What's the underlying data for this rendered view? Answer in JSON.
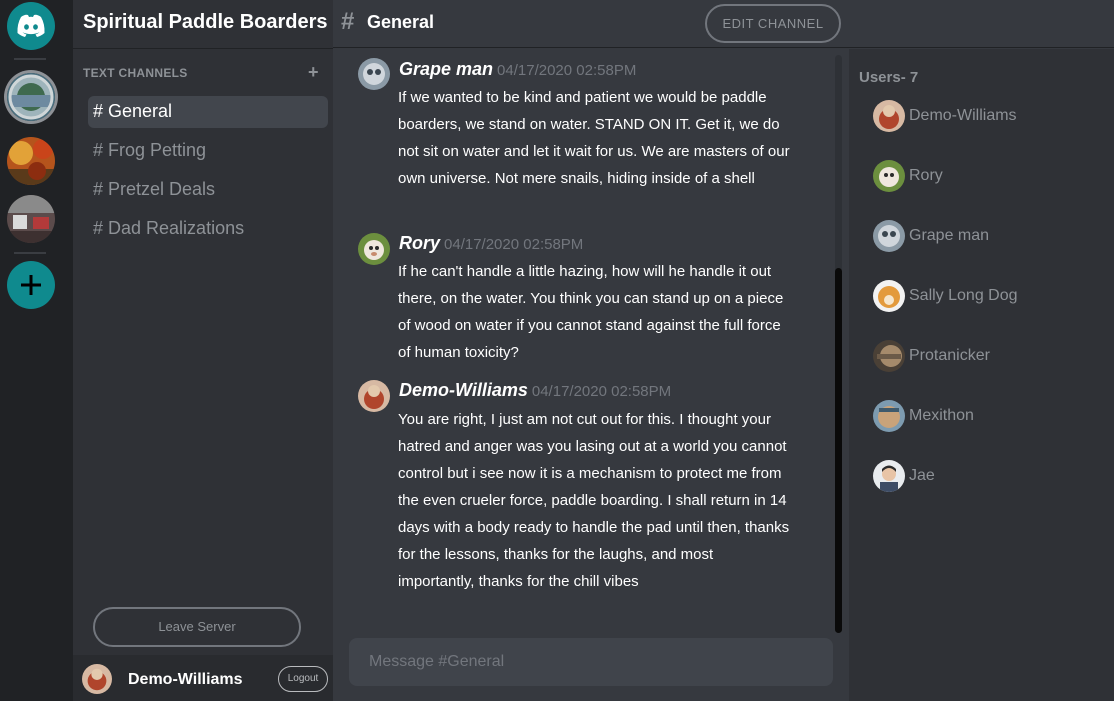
{
  "server": {
    "name": "Spiritual Paddle Boarders",
    "icons": [
      "discord-icon",
      "lake-icon",
      "autumn-icon",
      "patio-icon",
      "plus-icon"
    ]
  },
  "sidebar": {
    "section_label": "TEXT CHANNELS",
    "add_glyph": "+",
    "channels": [
      {
        "label": "# General",
        "active": true
      },
      {
        "label": "# Frog Petting",
        "active": false
      },
      {
        "label": "# Pretzel Deals",
        "active": false
      },
      {
        "label": "# Dad Realizations",
        "active": false
      }
    ],
    "leave_label": "Leave Server"
  },
  "user": {
    "name": "Demo-Williams",
    "logout_label": "Logout"
  },
  "header": {
    "hash": "#",
    "channel": "General",
    "edit_label": "EDIT CHANNEL"
  },
  "messages": [
    {
      "author": "Grape man",
      "time": "04/17/2020 02:58PM",
      "text": "If we wanted to be kind and patient we would be paddle boarders, we stand on water. STAND ON IT. Get it, we do not sit on water and let it wait for us. We are masters of our own universe. Not mere snails, hiding inside of a shell"
    },
    {
      "author": "Rory",
      "time": "04/17/2020 02:58PM",
      "text": "If he can't handle a little hazing, how will he handle it out there, on the water. You think you can stand up on a piece of wood on water if you cannot stand against the full force of human toxicity?"
    },
    {
      "author": "Demo-Williams",
      "time": "04/17/2020 02:58PM",
      "text": "You are right, I just am not cut out for this. I thought your hatred and anger was you lasing out at a world you cannot control but i see now it is a mechanism to protect me from the even crueler force, paddle boarding. I shall return in 14 days with a body ready to handle the pad until then, thanks for the lessons, thanks for the laughs, and most importantly, thanks for the chill vibes"
    }
  ],
  "composer": {
    "placeholder": "Message #General"
  },
  "members": {
    "title": "Users- 7",
    "list": [
      {
        "name": "Demo-Williams"
      },
      {
        "name": "Rory"
      },
      {
        "name": "Grape man"
      },
      {
        "name": "Sally Long Dog"
      },
      {
        "name": "Protanicker"
      },
      {
        "name": "Mexithon"
      },
      {
        "name": "Jae"
      }
    ]
  },
  "colors": {
    "accent": "#0f8a8e",
    "background": "#36393f",
    "sidebar": "#2f3136",
    "rail": "#202225"
  }
}
